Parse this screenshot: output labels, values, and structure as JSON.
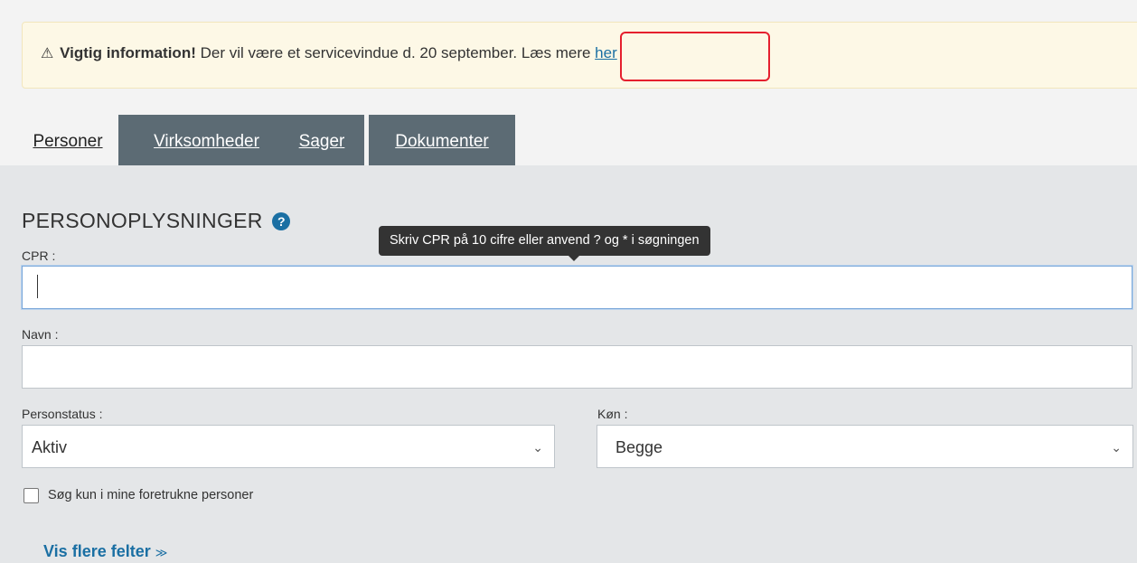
{
  "alert": {
    "title": "Vigtig information!",
    "message": "Der vil være et servicevindue d. 20 september.",
    "more_text": "Læs mere",
    "link_label": "her",
    "icon": "warning-triangle-icon"
  },
  "tabs": [
    {
      "label": "Personer",
      "active": true
    },
    {
      "label": "Virksomheder",
      "active": false
    },
    {
      "label": "Sager",
      "active": false
    },
    {
      "label": "Dokumenter",
      "active": false
    }
  ],
  "section": {
    "title": "PERSONOPLYSNINGER",
    "help_glyph": "?"
  },
  "cpr": {
    "label": "CPR :",
    "value": "",
    "tooltip": "Skriv CPR på 10 cifre eller anvend ? og * i søgningen"
  },
  "navn": {
    "label": "Navn :",
    "value": ""
  },
  "personstatus": {
    "label": "Personstatus :",
    "selected": "Aktiv"
  },
  "kon": {
    "label": "Køn :",
    "selected": "Begge"
  },
  "favorites_checkbox": {
    "label": "Søg kun i mine foretrukne personer",
    "checked": false
  },
  "more_fields": {
    "label": "Vis flere felter",
    "glyph": "≫"
  },
  "colors": {
    "accent": "#1a6fa3",
    "tab_inactive": "#5c6b74",
    "alert_bg": "#fdf8e6",
    "highlight": "#e5202e",
    "panel_bg": "#e4e6e8"
  }
}
